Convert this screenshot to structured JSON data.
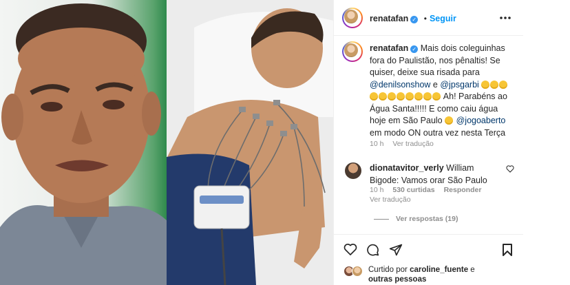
{
  "post": {
    "username": "renatafan",
    "follow_label": "Seguir",
    "caption": {
      "username": "renatafan",
      "text1": "Mais dois coleguinhas fora do Paulistão, nos pênaltis! Se quiser, deixe sua risada para",
      "mention1": "@denilsonshow",
      "and": "e",
      "mention2": "@jpsgarbi",
      "text2": "Ah! Parabéns ao Água Santa!!!!! E como caiu água hoje em São Paulo",
      "mention3": "@jogoaberto",
      "text3": "em modo ON outra vez nesta Terça",
      "time": "10 h",
      "translate": "Ver tradução"
    },
    "comment": {
      "username": "dionatavitor_verly",
      "text": "William Bigode: Vamos orar São Paulo",
      "time": "10 h",
      "likes": "530 curtidas",
      "reply": "Responder",
      "translate": "Ver tradução",
      "view_replies": "Ver respostas (19)"
    },
    "liked_by": {
      "prefix": "Curtido por",
      "user": "caroline_fuente",
      "suffix": "e",
      "others": "outras pessoas"
    }
  },
  "icons": [
    "more-icon",
    "verified-icon",
    "heart-icon",
    "comment-icon",
    "share-icon",
    "bookmark-icon",
    "emoji-laugh-icon",
    "emoji-worried-icon"
  ],
  "colors": {
    "link": "#0095f6",
    "mention": "#00376b",
    "meta": "#8e8e8e",
    "verified": "#3897f0"
  }
}
